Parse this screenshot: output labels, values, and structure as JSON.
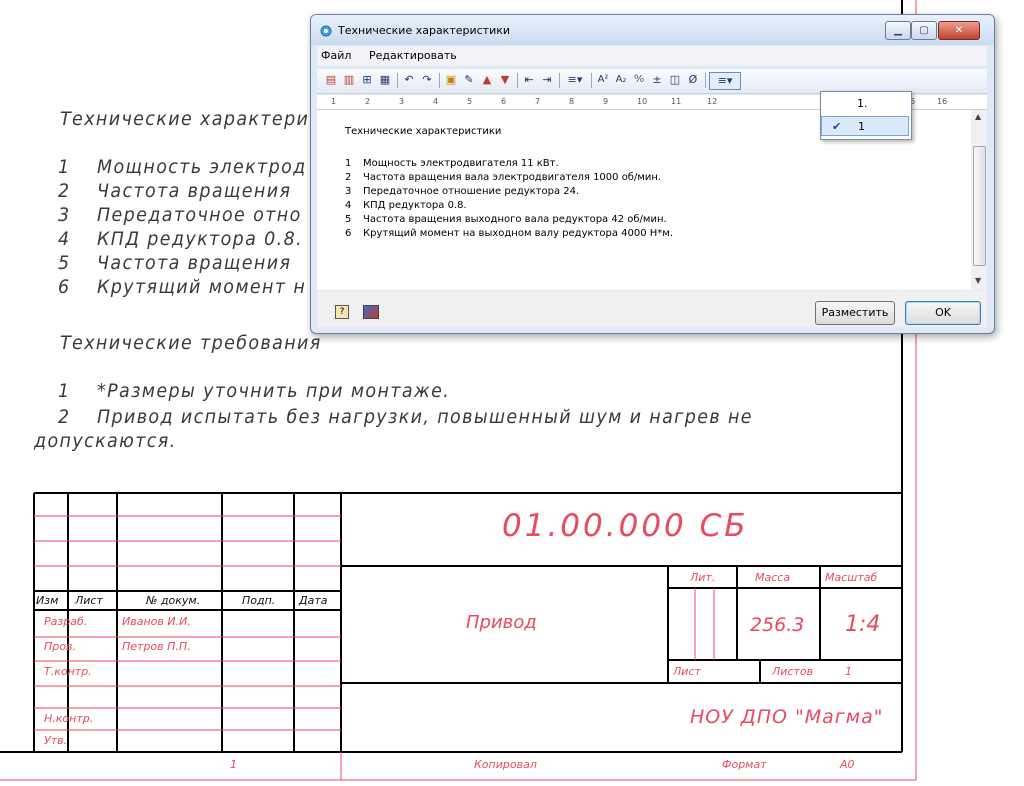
{
  "dialog": {
    "title": "Технические характеристики",
    "menu": [
      "Файл",
      "Редактировать"
    ],
    "ruler_labels": [
      "1",
      "2",
      "3",
      "4",
      "5",
      "6",
      "7",
      "8",
      "9",
      "10",
      "11",
      "12",
      "15",
      "16"
    ],
    "content_heading": "Технические характеристики",
    "lines": [
      {
        "num": "1",
        "text": "Мощность электродвигателя 11 кВт."
      },
      {
        "num": "2",
        "text": "Частота вращения вала электродвигателя 1000 об/мин."
      },
      {
        "num": "3",
        "text": "Передаточное отношение редуктора 24."
      },
      {
        "num": "4",
        "text": "КПД редуктора 0.8."
      },
      {
        "num": "5",
        "text": "Частота вращения выходного вала редуктора 42 об/мин."
      },
      {
        "num": "6",
        "text": "Крутящий момент на выходном валу редуктора 4000 Н*м."
      }
    ],
    "place_button": "Разместить",
    "ok_button": "OK",
    "numbering_dropdown": {
      "options": [
        "1.",
        "1"
      ],
      "selected": "1"
    },
    "toolbar_text": {
      "sup": "A²",
      "sub": "A₂",
      "percent": "⁰⁄₀",
      "pm": "±",
      "diam": "Ø"
    }
  },
  "drawing": {
    "tech_char_heading": "Технические характери",
    "tech_char_lines": [
      {
        "num": "1",
        "text": "Мощность электрод"
      },
      {
        "num": "2",
        "text": "Частота вращения"
      },
      {
        "num": "3",
        "text": "Передаточное отно"
      },
      {
        "num": "4",
        "text": "КПД редуктора 0.8."
      },
      {
        "num": "5",
        "text": "Частота вращения"
      },
      {
        "num": "6",
        "text": "Крутящий момент н"
      }
    ],
    "tech_req_heading": "Технические требования",
    "tech_req_line1_num": "1",
    "tech_req_line1": "*Размеры уточнить при монтаже.",
    "tech_req_line2_num": "2",
    "tech_req_line2": "Привод испытать без нагрузки, повышенный шум и нагрев не",
    "tech_req_line3": "допускаются.",
    "title_block": {
      "designation": "01.00.000 СБ",
      "name": "Привод",
      "headers": {
        "izm": "Изм",
        "list": "Лист",
        "doc": "№ докум.",
        "sign": "Подп.",
        "date": "Дата"
      },
      "roles": {
        "razrab": "Разраб.",
        "prov": "Пров.",
        "tkontr": "Т.контр.",
        "nkontr": "Н.контр.",
        "utv": "Утв."
      },
      "people": {
        "razrab": "Иванов И.И.",
        "prov": "Петров П.П."
      },
      "lit": "Лит.",
      "mass_label": "Масса",
      "scale_label": "Масштаб",
      "mass": "256.3",
      "scale": "1:4",
      "sheet": "Лист",
      "sheets_label": "Листов",
      "sheets": "1",
      "org": "НОУ ДПО \"Магма\"",
      "footer_sheet": "1",
      "copied": "Копировал",
      "format_label": "Формат",
      "format": "А0"
    }
  },
  "colors": {
    "accent_red": "#e84a5f",
    "drawing_text": "#3a3a3a"
  }
}
